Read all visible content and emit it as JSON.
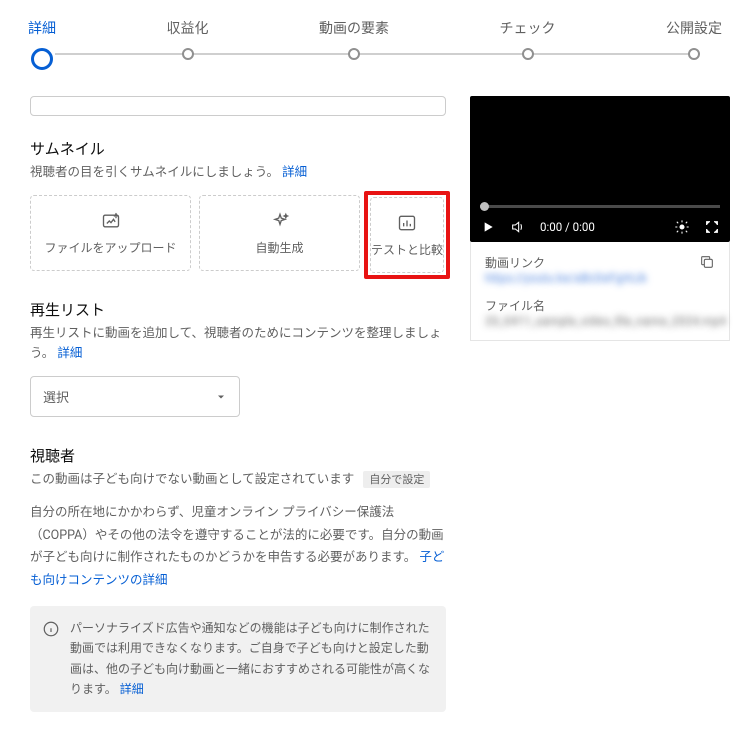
{
  "stepper": {
    "steps": [
      "詳細",
      "収益化",
      "動画の要素",
      "チェック",
      "公開設定"
    ],
    "activeIndex": 0
  },
  "thumbnail": {
    "heading": "サムネイル",
    "sub_pre": "視聴者の目を引くサムネイルにしましょう。",
    "sub_link": "詳細",
    "cards": {
      "upload": "ファイルをアップロード",
      "autogen": "自動生成",
      "test": "テストと比較"
    }
  },
  "playlist": {
    "heading": "再生リスト",
    "sub_pre": "再生リストに動画を追加して、視聴者のためにコンテンツを整理しましょう。",
    "sub_link": "詳細",
    "select_label": "選択"
  },
  "audience": {
    "heading": "視聴者",
    "status_text": "この動画は子ども向けでない動画として設定されています",
    "status_badge": "自分で設定",
    "body": "自分の所在地にかかわらず、児童オンライン プライバシー保護法（COPPA）やその他の法令を遵守することが法的に必要です。自分の動画が子ども向けに制作されたものかどうかを申告する必要があります。",
    "body_link": "子ども向けコンテンツの詳細",
    "notice": "パーソナライズド広告や通知などの機能は子ども向けに制作された動画では利用できなくなります。ご自身で子ども向けと設定した動画は、他の子ども向け動画と一緒におすすめされる可能性が高くなります。",
    "notice_link": "詳細"
  },
  "preview": {
    "time": "0:00 / 0:00",
    "link_label": "動画リンク",
    "link_value": "https://youtu.be/aBcDeFgHiJk",
    "file_label": "ファイル名",
    "file_value": "20_0411_sample_video_file_name_2024.mp4"
  }
}
